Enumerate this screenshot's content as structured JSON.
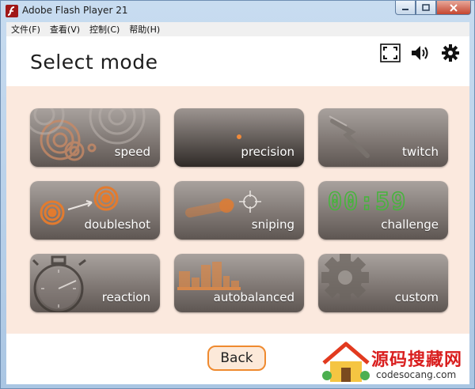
{
  "window": {
    "title": "Adobe Flash Player 21",
    "controls": [
      "minimize",
      "maximize",
      "close"
    ]
  },
  "menu": [
    {
      "label": "文件(F)"
    },
    {
      "label": "查看(V)"
    },
    {
      "label": "控制(C)"
    },
    {
      "label": "帮助(H)"
    }
  ],
  "page": {
    "title": "Select mode",
    "top_icons": [
      "fullscreen-icon",
      "speaker-icon",
      "gear-icon"
    ]
  },
  "modes": [
    {
      "label": "speed",
      "art": "concentric-circles"
    },
    {
      "label": "precision",
      "art": "small-dot"
    },
    {
      "label": "twitch",
      "art": "motion-streak"
    },
    {
      "label": "doubleshot",
      "art": "two-targets"
    },
    {
      "label": "sniping",
      "art": "crosshair"
    },
    {
      "label": "challenge",
      "art": "lcd-timer",
      "timer_text": "00:59"
    },
    {
      "label": "reaction",
      "art": "stopwatch"
    },
    {
      "label": "autobalanced",
      "art": "bar-blocks"
    },
    {
      "label": "custom",
      "art": "gear"
    }
  ],
  "back_button": {
    "label": "Back"
  },
  "watermark": {
    "line1": "源码搜藏网",
    "line2": "codesocang.com"
  },
  "colors": {
    "accent_orange": "#ef8a2f",
    "panel_background": "#fbe9de",
    "lcd_green": "#3fae3a"
  }
}
